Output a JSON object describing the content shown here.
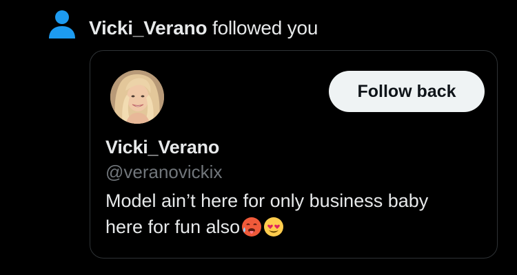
{
  "colors": {
    "background": "#000000",
    "text": "#e7e9ea",
    "muted": "#71767b",
    "accent": "#1d9bf0",
    "card_border": "#2f3336",
    "button_bg": "#eff3f4",
    "button_text": "#0f1419"
  },
  "notification": {
    "icon": "person-icon",
    "username": "Vicki_Verano",
    "action": " followed you"
  },
  "card": {
    "avatar_icon": "profile-photo",
    "follow_button_label": "Follow back",
    "display_name": "Vicki_Verano",
    "handle": "@veranovickix",
    "bio_line1": "Model ain’t here for only business baby",
    "bio_line2": "here for fun also",
    "bio_emojis": [
      "hot-face-emoji",
      "heart-eyes-emoji"
    ]
  }
}
